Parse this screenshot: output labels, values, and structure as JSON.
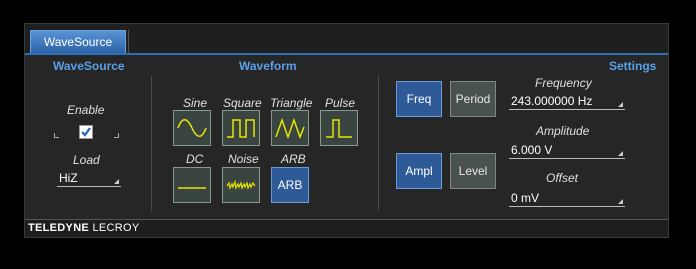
{
  "tab": {
    "label": "WaveSource"
  },
  "sections": {
    "wavesource": "WaveSource",
    "waveform": "Waveform",
    "settings": "Settings"
  },
  "wavesource": {
    "enable_label": "Enable",
    "enable_checked": true,
    "load_label": "Load",
    "load_value": "HiZ"
  },
  "waveform": {
    "buttons": [
      {
        "label": "Sine",
        "icon": "sine-wave-icon"
      },
      {
        "label": "Square",
        "icon": "square-wave-icon"
      },
      {
        "label": "Triangle",
        "icon": "triangle-wave-icon"
      },
      {
        "label": "Pulse",
        "icon": "pulse-wave-icon"
      },
      {
        "label": "DC",
        "icon": "dc-line-icon"
      },
      {
        "label": "Noise",
        "icon": "noise-wave-icon"
      },
      {
        "label": "ARB",
        "button_text": "ARB",
        "selected": true
      }
    ]
  },
  "settings": {
    "freq_button": "Freq",
    "period_button": "Period",
    "ampl_button": "Ampl",
    "level_button": "Level",
    "frequency_label": "Frequency",
    "frequency_value": "243.000000 Hz",
    "amplitude_label": "Amplitude",
    "amplitude_value": "6.000 V",
    "offset_label": "Offset",
    "offset_value": "0 mV"
  },
  "footer": {
    "brand_bold": "TELEDYNE",
    "brand_regular": "LECROY"
  },
  "colors": {
    "accent": "#5aa0e8",
    "selected": "#2f5a98",
    "panel": "#262626"
  }
}
